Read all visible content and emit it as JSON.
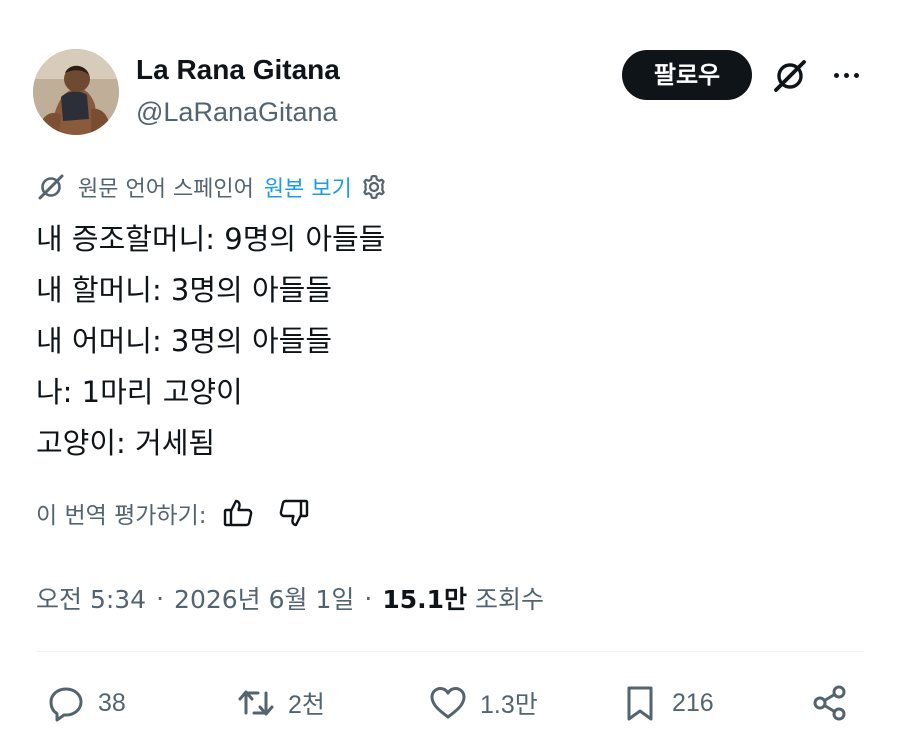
{
  "author": {
    "name": "La Rana Gitana",
    "handle": "@LaRanaGitana"
  },
  "header": {
    "follow_label": "팔로우"
  },
  "translation": {
    "note": "원문 언어 스페인어",
    "show_original_label": "원본 보기"
  },
  "tweet": {
    "lines": [
      "내 증조할머니: 9명의 아들들",
      "내 할머니: 3명의 아들들",
      "내 어머니: 3명의 아들들",
      "나: 1마리 고양이",
      "고양이: 거세됨"
    ]
  },
  "rating": {
    "prompt": "이 번역 평가하기:"
  },
  "meta": {
    "time": "오전 5:34",
    "separator": "·",
    "date": "2026년 6월 1일",
    "views_count": "15.1만",
    "views_label": "조회수"
  },
  "actions": {
    "replies": "38",
    "retweets": "2천",
    "likes": "1.3만",
    "bookmarks": "216"
  },
  "icons": {
    "translate": "grok-translate-icon",
    "settings": "gear-icon",
    "more": "more-icon",
    "reply": "reply-icon",
    "retweet": "retweet-icon",
    "like": "heart-icon",
    "bookmark": "bookmark-icon",
    "share": "share-icon",
    "thumbs_up": "thumbs-up-icon",
    "thumbs_down": "thumbs-down-icon"
  },
  "colors": {
    "text": "#0f1419",
    "secondary": "#536471",
    "link": "#1d9bf0",
    "follow_bg": "#0f1419"
  }
}
